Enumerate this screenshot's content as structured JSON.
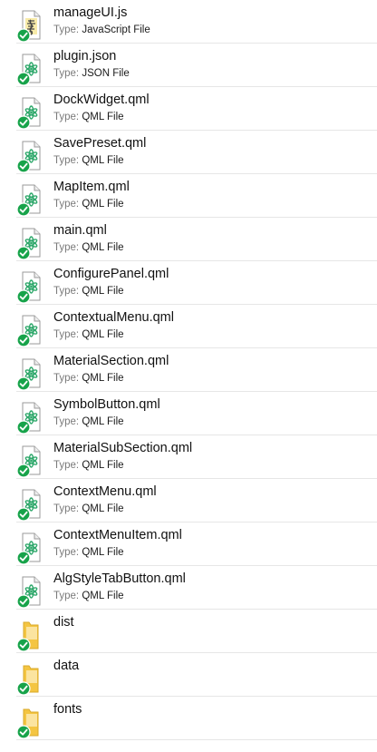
{
  "type_label": "Type:",
  "files": [
    {
      "name": "manageUI.js",
      "type": "JavaScript File",
      "icon": "js-file-icon"
    },
    {
      "name": "plugin.json",
      "type": "JSON File",
      "icon": "qt-file-icon"
    },
    {
      "name": "DockWidget.qml",
      "type": "QML File",
      "icon": "qt-file-icon"
    },
    {
      "name": "SavePreset.qml",
      "type": "QML File",
      "icon": "qt-file-icon"
    },
    {
      "name": "MapItem.qml",
      "type": "QML File",
      "icon": "qt-file-icon"
    },
    {
      "name": "main.qml",
      "type": "QML File",
      "icon": "qt-file-icon"
    },
    {
      "name": "ConfigurePanel.qml",
      "type": "QML File",
      "icon": "qt-file-icon"
    },
    {
      "name": "ContextualMenu.qml",
      "type": "QML File",
      "icon": "qt-file-icon"
    },
    {
      "name": "MaterialSection.qml",
      "type": "QML File",
      "icon": "qt-file-icon"
    },
    {
      "name": "SymbolButton.qml",
      "type": "QML File",
      "icon": "qt-file-icon"
    },
    {
      "name": "MaterialSubSection.qml",
      "type": "QML File",
      "icon": "qt-file-icon"
    },
    {
      "name": "ContextMenu.qml",
      "type": "QML File",
      "icon": "qt-file-icon"
    },
    {
      "name": "ContextMenuItem.qml",
      "type": "QML File",
      "icon": "qt-file-icon"
    },
    {
      "name": "AlgStyleTabButton.qml",
      "type": "QML File",
      "icon": "qt-file-icon"
    }
  ],
  "folders": [
    {
      "name": "dist",
      "icon": "folder-icon"
    },
    {
      "name": "data",
      "icon": "folder-icon"
    },
    {
      "name": "fonts",
      "icon": "folder-icon"
    }
  ],
  "colors": {
    "sync_badge": "#17a34a",
    "folder": "#f4c542",
    "qt_logo": "#2fa86b"
  }
}
